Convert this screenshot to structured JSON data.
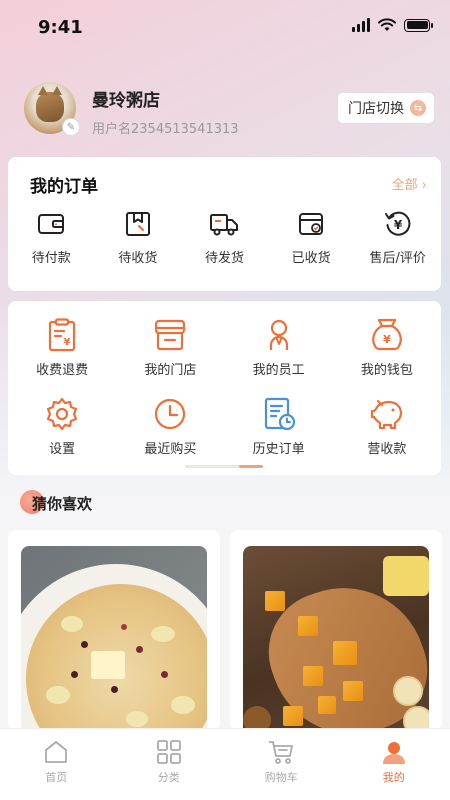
{
  "status_bar": {
    "time": "9:41"
  },
  "profile": {
    "shop_name": "曼玲粥店",
    "username": "用户名2354513541313",
    "switch_label": "门店切换"
  },
  "orders": {
    "title": "我的订单",
    "view_all": "全部",
    "items": [
      {
        "label": "待付款",
        "icon": "wallet-icon"
      },
      {
        "label": "待收货",
        "icon": "package-icon"
      },
      {
        "label": "待发货",
        "icon": "truck-icon"
      },
      {
        "label": "已收货",
        "icon": "received-icon"
      },
      {
        "label": "售后/评价",
        "icon": "refund-icon"
      }
    ]
  },
  "tools": {
    "items": [
      {
        "label": "收费退费",
        "icon": "clipboard-yen-icon"
      },
      {
        "label": "我的门店",
        "icon": "store-icon"
      },
      {
        "label": "我的员工",
        "icon": "staff-icon"
      },
      {
        "label": "我的钱包",
        "icon": "money-bag-icon"
      },
      {
        "label": "设置",
        "icon": "gear-icon"
      },
      {
        "label": "最近购买",
        "icon": "clock-icon"
      },
      {
        "label": "历史订单",
        "icon": "history-doc-icon"
      },
      {
        "label": "营收款",
        "icon": "piggy-bank-icon"
      }
    ]
  },
  "guess": {
    "title": "猜你喜欢"
  },
  "tabbar": {
    "items": [
      {
        "label": "首页",
        "icon": "home-icon"
      },
      {
        "label": "分类",
        "icon": "grid-icon"
      },
      {
        "label": "购物车",
        "icon": "cart-icon"
      },
      {
        "label": "我的",
        "icon": "user-icon"
      }
    ],
    "active_index": 3
  },
  "colors": {
    "accent": "#ee6f3a",
    "accent_light": "#f2a17c",
    "tab_inactive": "#aaaaaa"
  }
}
